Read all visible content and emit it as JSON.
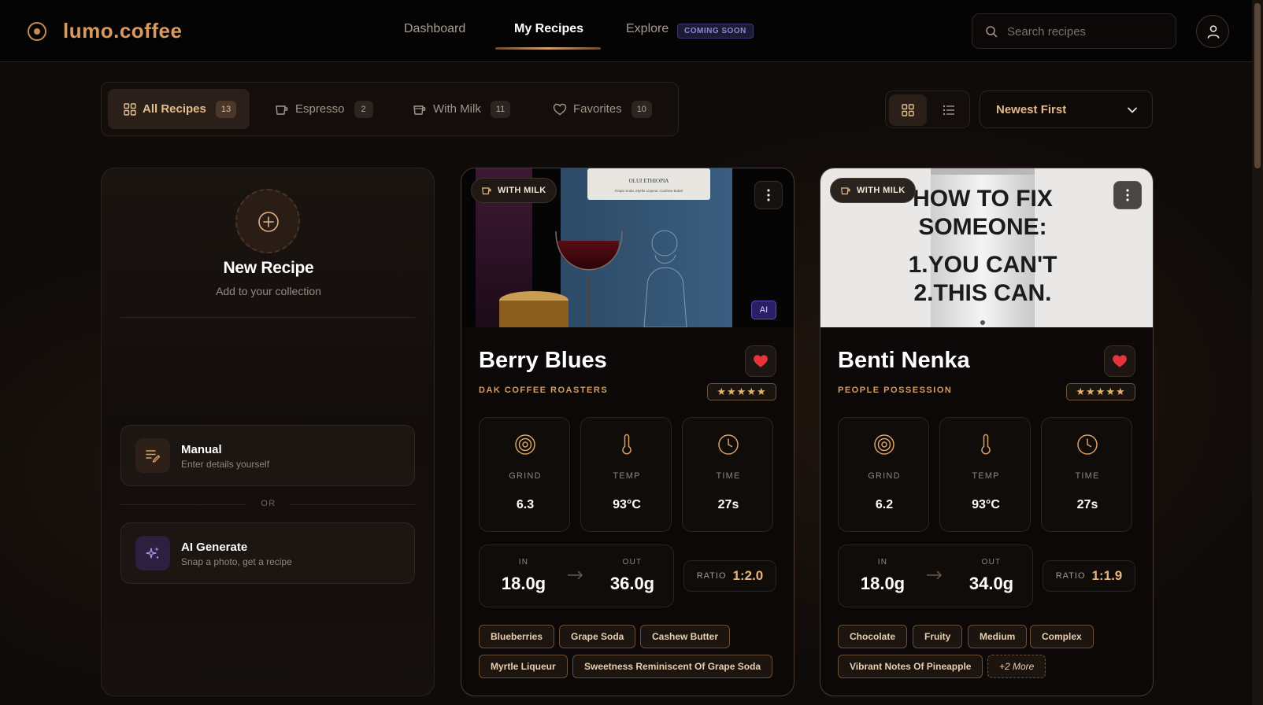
{
  "brand": {
    "name": "lumo.coffee",
    "accent": "#d79a60"
  },
  "nav": {
    "items": [
      {
        "label": "Dashboard"
      },
      {
        "label": "My Recipes"
      },
      {
        "label": "Explore"
      }
    ],
    "explore_badge": "COMING SOON"
  },
  "search": {
    "placeholder": "Search recipes",
    "value": ""
  },
  "filters": [
    {
      "label": "All Recipes",
      "count": "13",
      "icon": "grid-icon"
    },
    {
      "label": "Espresso",
      "count": "2",
      "icon": "cup-icon"
    },
    {
      "label": "With Milk",
      "count": "11",
      "icon": "milk-cup-icon"
    },
    {
      "label": "Favorites",
      "count": "10",
      "icon": "heart-outline-icon"
    }
  ],
  "sort": {
    "selected": "Newest First"
  },
  "new_recipe": {
    "title": "New Recipe",
    "subtitle": "Add to your collection",
    "manual": {
      "title": "Manual",
      "desc": "Enter details yourself"
    },
    "or": "OR",
    "ai": {
      "title": "AI Generate",
      "desc": "Snap a photo, get a recipe"
    }
  },
  "recipes": [
    {
      "type": "WITH MILK",
      "ai_badge": "AI",
      "name": "Berry Blues",
      "roaster": "DAK COFFEE ROASTERS",
      "stars": "★★★★★",
      "rating": 5,
      "stats": [
        {
          "label": "GRIND",
          "value": "6.3"
        },
        {
          "label": "TEMP",
          "value": "93°C"
        },
        {
          "label": "TIME",
          "value": "27s"
        }
      ],
      "in_label": "IN",
      "in_value": "18.0g",
      "out_label": "OUT",
      "out_value": "36.0g",
      "ratio_label": "RATIO",
      "ratio_value": "1:2.0",
      "image_text": "OLUI ETHIOPIA",
      "image_subtext": "Grape Soda, Myrtle Liqueur, Cashew Butter",
      "tags": [
        "Blueberries",
        "Grape Soda",
        "Cashew Butter",
        "Myrtle Liqueur",
        "Sweetness Reminiscent Of Grape Soda"
      ]
    },
    {
      "type": "WITH MILK",
      "name": "Benti Nenka",
      "roaster": "PEOPLE POSSESSION",
      "stars": "★★★★★",
      "rating": 5,
      "stats": [
        {
          "label": "GRIND",
          "value": "6.2"
        },
        {
          "label": "TEMP",
          "value": "93°C"
        },
        {
          "label": "TIME",
          "value": "27s"
        }
      ],
      "in_label": "IN",
      "in_value": "18.0g",
      "out_label": "OUT",
      "out_value": "34.0g",
      "ratio_label": "RATIO",
      "ratio_value": "1:1.9",
      "image_lines": [
        "HOW TO FIX",
        "SOMEONE:",
        "1.YOU CAN'T",
        "2.THIS CAN."
      ],
      "tags": [
        "Chocolate",
        "Fruity",
        "Medium",
        "Complex",
        "Vibrant Notes Of Pineapple"
      ],
      "more_tag": "+2 More"
    }
  ]
}
